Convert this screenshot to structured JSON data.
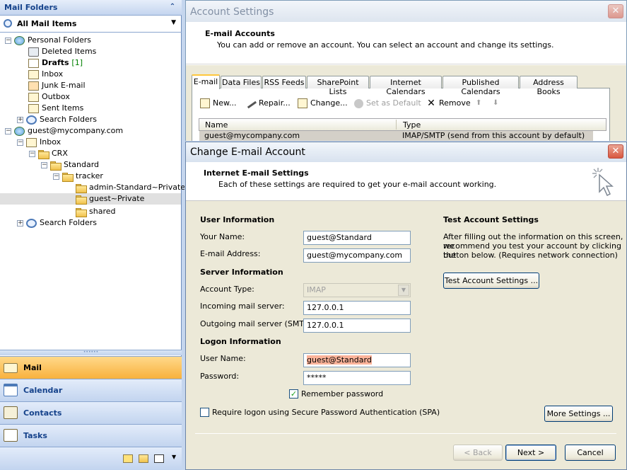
{
  "nav": {
    "header": "Mail Folders",
    "all_items": "All Mail Items",
    "tree": [
      {
        "label": "Personal Folders",
        "count": ""
      },
      {
        "label": "Deleted Items",
        "count": ""
      },
      {
        "label": "Drafts",
        "count": "[1]"
      },
      {
        "label": "Inbox",
        "count": ""
      },
      {
        "label": "Junk E-mail",
        "count": ""
      },
      {
        "label": "Outbox",
        "count": ""
      },
      {
        "label": "Sent Items",
        "count": ""
      },
      {
        "label": "Search Folders",
        "count": ""
      },
      {
        "label": "guest@mycompany.com",
        "count": ""
      },
      {
        "label": "Inbox",
        "count": ""
      },
      {
        "label": "CRX",
        "count": ""
      },
      {
        "label": "Standard",
        "count": ""
      },
      {
        "label": "tracker",
        "count": ""
      },
      {
        "label": "admin-Standard~Private",
        "count": ""
      },
      {
        "label": "guest~Private",
        "count": ""
      },
      {
        "label": "shared",
        "count": ""
      },
      {
        "label": "Search Folders",
        "count": ""
      }
    ],
    "buttons": {
      "mail": "Mail",
      "calendar": "Calendar",
      "contacts": "Contacts",
      "tasks": "Tasks"
    }
  },
  "account_settings": {
    "title": "Account Settings",
    "section_title": "E-mail Accounts",
    "section_desc": "You can add or remove an account. You can select an account and change its settings.",
    "tabs": [
      "E-mail",
      "Data Files",
      "RSS Feeds",
      "SharePoint Lists",
      "Internet Calendars",
      "Published Calendars",
      "Address Books"
    ],
    "toolbar": {
      "new": "New...",
      "repair": "Repair...",
      "change": "Change...",
      "set_default": "Set as Default",
      "remove": "Remove"
    },
    "columns": {
      "name": "Name",
      "type": "Type"
    },
    "row": {
      "name": "guest@mycompany.com",
      "type": "IMAP/SMTP (send from this account by default)"
    }
  },
  "dialog": {
    "title": "Change E-mail Account",
    "section_title": "Internet E-mail Settings",
    "section_desc": "Each of these settings are required to get your e-mail account working.",
    "user_info": "User Information",
    "your_name_label": "Your Name:",
    "your_name": "guest@Standard",
    "email_label": "E-mail Address:",
    "email": "guest@mycompany.com",
    "server_info": "Server Information",
    "account_type_label": "Account Type:",
    "account_type": "IMAP",
    "incoming_label": "Incoming mail server:",
    "incoming": "127.0.0.1",
    "outgoing_label": "Outgoing mail server (SMTP):",
    "outgoing": "127.0.0.1",
    "logon_info": "Logon Information",
    "username_label": "User Name:",
    "username": "guest@Standard",
    "password_label": "Password:",
    "password": "*****",
    "remember_password": "Remember password",
    "remember_checked": true,
    "spa": "Require logon using Secure Password Authentication (SPA)",
    "test_title": "Test Account Settings",
    "test_desc_1": "After filling out the information on this screen, we",
    "test_desc_2": "recommend you test your account by clicking the",
    "test_desc_3": "button below. (Requires network connection)",
    "test_button": "Test Account Settings ...",
    "more_settings": "More Settings ...",
    "back": "< Back",
    "next": "Next >",
    "cancel": "Cancel"
  }
}
